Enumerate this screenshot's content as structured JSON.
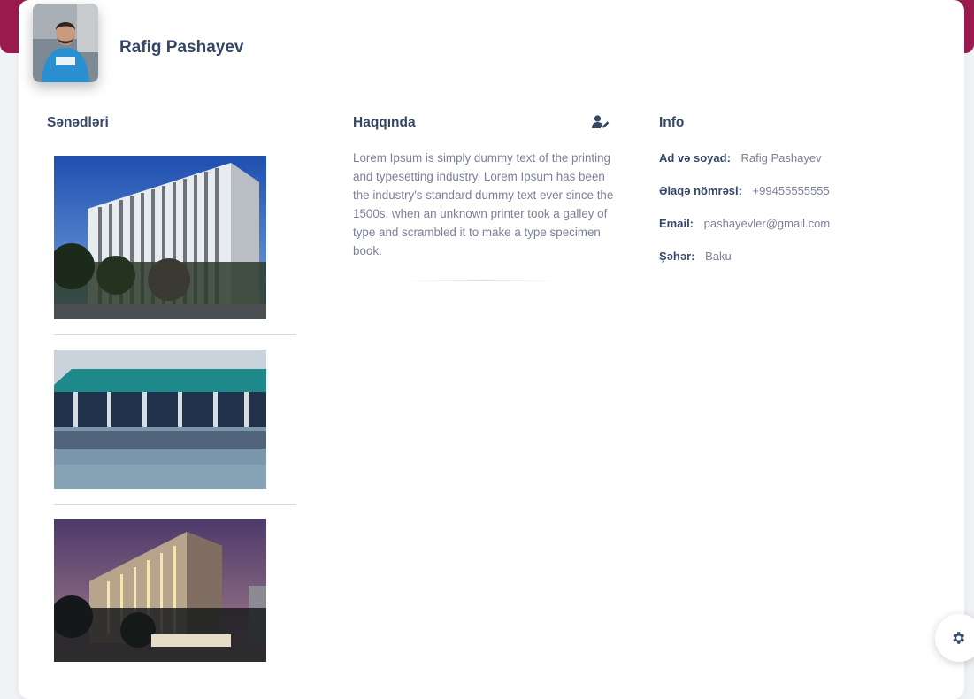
{
  "profile": {
    "name": "Rafig Pashayev"
  },
  "documents": {
    "title": "Sənədləri",
    "images": [
      {
        "name": "building-photo-1"
      },
      {
        "name": "building-photo-2"
      },
      {
        "name": "building-photo-3"
      }
    ]
  },
  "about": {
    "title": "Haqqında",
    "text": "Lorem Ipsum is simply dummy text of the printing and typesetting industry. Lorem Ipsum has been the industry's standard dummy text ever since the 1500s, when an unknown printer took a galley of type and scrambled it to make a type specimen book.",
    "edit_icon": "user-edit-icon"
  },
  "info": {
    "title": "Info",
    "rows": [
      {
        "label": "Ad və soyad:",
        "value": "Rafig Pashayev"
      },
      {
        "label": "Əlaqə nömrəsi:",
        "value": "+99455555555"
      },
      {
        "label": "Email:",
        "value": "pashayevler@gmail.com"
      },
      {
        "label": "Şəhər:",
        "value": "Baku"
      }
    ]
  },
  "colors": {
    "brand": "#9b1b4f",
    "heading": "#344767",
    "text": "#7b809a"
  },
  "settings_icon": "gear-icon"
}
